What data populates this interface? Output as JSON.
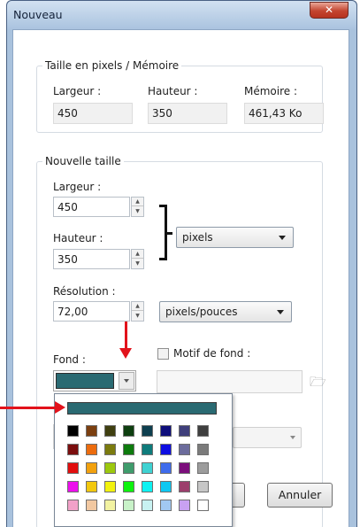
{
  "window": {
    "title": "Nouveau"
  },
  "current": {
    "legend": "Taille en pixels / Mémoire",
    "width_label": "Largeur :",
    "width_value": "450",
    "height_label": "Hauteur :",
    "height_value": "350",
    "memory_label": "Mémoire :",
    "memory_value": "461,43 Ko"
  },
  "new_size": {
    "legend": "Nouvelle taille",
    "width_label": "Largeur :",
    "width_value": "450",
    "height_label": "Hauteur :",
    "height_value": "350",
    "unit": "pixels",
    "resolution_label": "Résolution :",
    "resolution_value": "72,00",
    "resolution_unit": "pixels/pouces"
  },
  "background": {
    "label": "Fond :",
    "pattern_label": "Motif de fond :",
    "selected_color": "#2a6a72"
  },
  "buttons": {
    "cancel": "Annuler"
  },
  "palette": {
    "rows": [
      [
        "#000000",
        "#7b3f10",
        "#3f3f10",
        "#0e3f10",
        "#0e3f4f",
        "#0e0e7b",
        "#3f3f7b",
        "#3f3f3f"
      ],
      [
        "#7b0e0e",
        "#ec6c0e",
        "#7b7b0e",
        "#0e7b0e",
        "#0e7b7b",
        "#0e0ee2",
        "#6c6c9c",
        "#7b7b7b"
      ],
      [
        "#e20e0e",
        "#f2a10e",
        "#9cc80e",
        "#3f9c6c",
        "#3fd2d2",
        "#3f6cec",
        "#7b0e7b",
        "#9c9c9c"
      ],
      [
        "#ec0eec",
        "#f2c80e",
        "#f2f20e",
        "#0ef20e",
        "#0ef2f2",
        "#0ec8f2",
        "#9c3f6c",
        "#c6c6c6"
      ],
      [
        "#f2a1c8",
        "#f2c8a1",
        "#f2f2a1",
        "#c8f2c8",
        "#c8f2f2",
        "#a1c8f2",
        "#c8a1f2",
        "#ffffff"
      ]
    ]
  },
  "colors": {
    "annotation_red": "#e2121b",
    "titlebar": "#aac3df"
  }
}
